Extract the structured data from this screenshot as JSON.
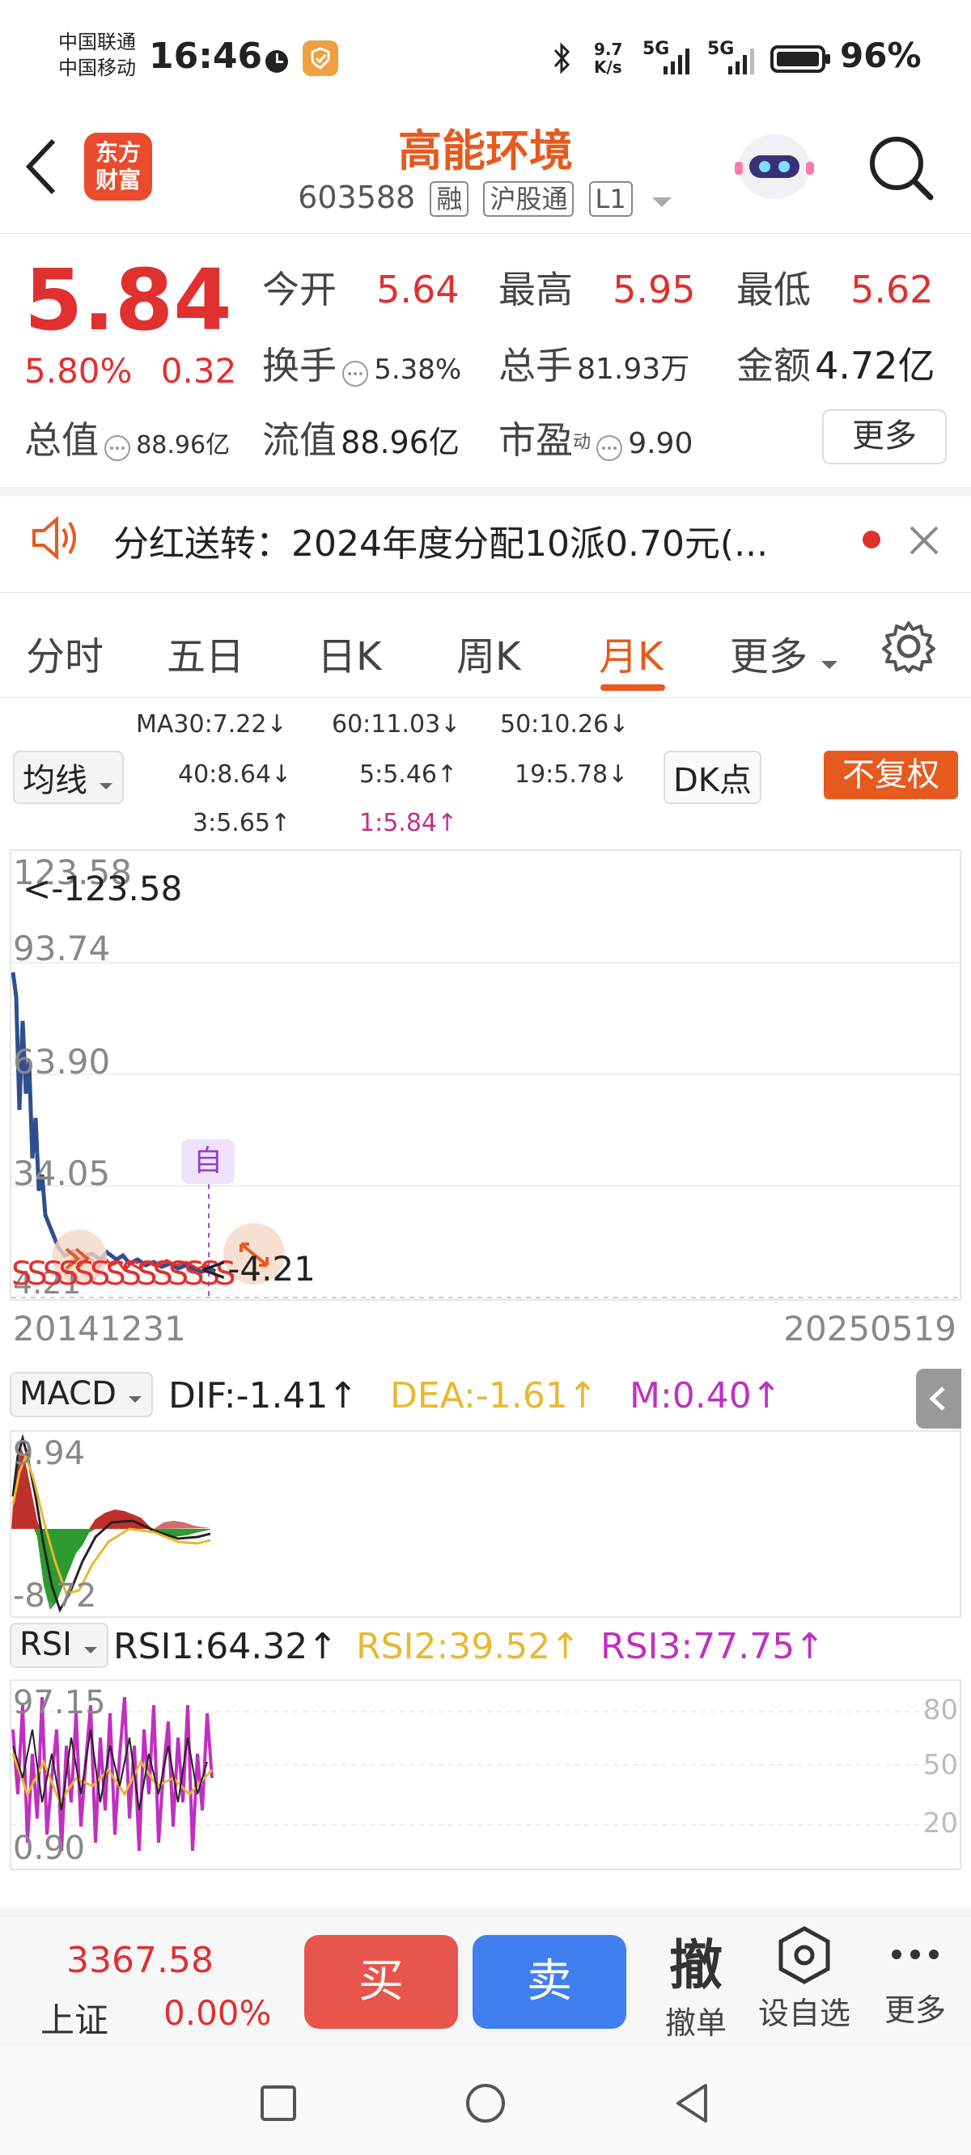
{
  "status_bar": {
    "carrier_1": "中国联通",
    "carrier_2": "中国移动",
    "time": "16:46",
    "net_speed_top": "9.7",
    "net_speed_bottom": "K/s",
    "signal_1": "5G",
    "signal_2": "5G",
    "battery": "96%"
  },
  "header": {
    "brand_logo_line1": "东方",
    "brand_logo_line2": "财富",
    "title": "高能环境",
    "code": "603588",
    "tags": [
      "融",
      "沪股通",
      "L1"
    ]
  },
  "quote": {
    "price": "5.84",
    "change_pct": "5.80%",
    "change": "0.32",
    "open_label": "今开",
    "open": "5.64",
    "high_label": "最高",
    "high": "5.95",
    "low_label": "最低",
    "low": "5.62",
    "turnover_label": "换手",
    "turnover": "5.38%",
    "volume_label": "总手",
    "volume": "81.93万",
    "amount_label": "金额",
    "amount": "4.72亿",
    "mcap_label": "总值",
    "mcap": "88.96亿",
    "float_label": "流值",
    "float": "88.96亿",
    "pe_label": "市盈",
    "pe_sup": "动",
    "pe": "9.90",
    "more_button": "更多"
  },
  "notice": {
    "text": "分红送转：2024年度分配10派0.70元(..."
  },
  "tabs": [
    "分时",
    "五日",
    "日K",
    "周K",
    "月K",
    "更多"
  ],
  "active_tab": "月K",
  "ma": {
    "selector": "均线",
    "ma30": "MA30:7.22↓",
    "ma60": "60:11.03↓",
    "ma50": "50:10.26↓",
    "ma40": "40:8.64↓",
    "ma5": "5:5.46↑",
    "ma19": "19:5.78↓",
    "ma3": "3:5.65↑",
    "ma1": "1:5.84↑",
    "dk_button": "DK点",
    "adjust_button": "不复权"
  },
  "kline": {
    "y_labels": [
      "123.58",
      "93.74",
      "63.90",
      "34.05",
      "4.21"
    ],
    "max_marker": "<-123.58",
    "min_marker": "<-4.21",
    "self_marker": "自",
    "start_date": "20141231",
    "end_date": "20250519"
  },
  "macd": {
    "selector": "MACD",
    "dif": "DIF:-1.41↑",
    "dea": "DEA:-1.61↑",
    "m": "M:0.40↑",
    "y_top": "9.94",
    "y_bottom": "-8.72"
  },
  "rsi": {
    "selector": "RSI",
    "rsi1": "RSI1:64.32↑",
    "rsi2": "RSI2:39.52↑",
    "rsi3": "RSI3:77.75↑",
    "y_top": "97.15",
    "y_bottom": "0.90",
    "levels": [
      "80",
      "50",
      "20"
    ]
  },
  "bottom": {
    "index_value": "3367.58",
    "index_name": "上证",
    "index_change": "0.00%",
    "buy": "买",
    "sell": "卖",
    "cancel_icon_text": "撤",
    "cancel_label": "撤单",
    "watch_label": "设自选",
    "more_label": "更多"
  },
  "colors": {
    "accent": "#e65a1f",
    "up": "#e03030",
    "down": "#2f9a2f",
    "buy": "#e8554d",
    "sell": "#3f7ff0"
  }
}
